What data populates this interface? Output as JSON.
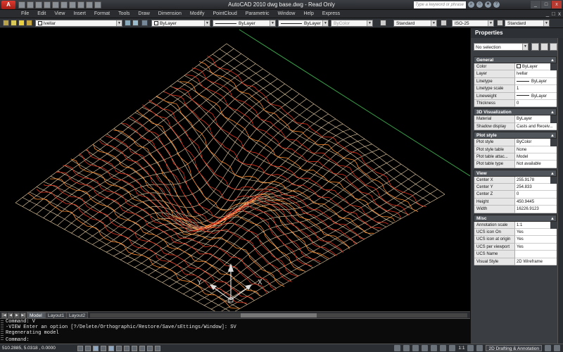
{
  "window": {
    "app_logo": "A",
    "title": "AutoCAD 2010    dwg base.dwg - Read Only",
    "search_placeholder": "Type a keyword or phrase",
    "controls": [
      "_",
      "□",
      "x"
    ]
  },
  "menu": {
    "items": [
      "File",
      "Edit",
      "View",
      "Insert",
      "Format",
      "Tools",
      "Draw",
      "Dimension",
      "Modify",
      "PointCloud",
      "Parametric",
      "Window",
      "Help",
      "Express"
    ],
    "right_controls": [
      "_",
      "□",
      "x"
    ]
  },
  "toolbar": {
    "layer": "lvellar",
    "color": "ByLayer",
    "linetype": "ByLayer",
    "lineweight": "ByLayer",
    "plot_style": "ByColor",
    "text_style": "Standard",
    "dim_style": "ISO-25",
    "table_style": "Standard"
  },
  "layout_tabs": [
    "Model",
    "Layout1",
    "Layout2"
  ],
  "ucs_axis_labels": {
    "x": "X",
    "y": "Y",
    "z": "Z"
  },
  "command_line": {
    "lines": [
      "Command: V",
      "-VIEW Enter an option [?/Delete/Orthographic/Restore/Save/sEttings/Window]: SV",
      "Regenerating model"
    ],
    "prompt": "Command:"
  },
  "status_bar": {
    "coordinates": "510.2885, 5.0318  , 0.0000",
    "scale": "1:1",
    "workspace": "2D Drafting & Annotation"
  },
  "properties": {
    "title": "Properties",
    "selection": "No selection",
    "sections": [
      {
        "name": "General",
        "rows": [
          {
            "name": "Color",
            "value": "ByLayer"
          },
          {
            "name": "Layer",
            "value": "lvellar"
          },
          {
            "name": "Linetype",
            "value": "ByLayer"
          },
          {
            "name": "Linetype scale",
            "value": "1"
          },
          {
            "name": "Lineweight",
            "value": "ByLayer"
          },
          {
            "name": "Thickness",
            "value": "0"
          }
        ]
      },
      {
        "name": "3D Visualization",
        "rows": [
          {
            "name": "Material",
            "value": "ByLayer"
          },
          {
            "name": "Shadow display",
            "value": "Casts and Receiv..."
          }
        ]
      },
      {
        "name": "Plot style",
        "rows": [
          {
            "name": "Plot style",
            "value": "ByColor"
          },
          {
            "name": "Plot style table",
            "value": "None"
          },
          {
            "name": "Plot table attac...",
            "value": "Model"
          },
          {
            "name": "Plot table type",
            "value": "Not available"
          }
        ]
      },
      {
        "name": "View",
        "rows": [
          {
            "name": "Center X",
            "value": "255.9178"
          },
          {
            "name": "Center Y",
            "value": "254.833"
          },
          {
            "name": "Center Z",
            "value": "0"
          },
          {
            "name": "Height",
            "value": "450.9445"
          },
          {
            "name": "Width",
            "value": "16226.9123"
          }
        ]
      },
      {
        "name": "Misc",
        "rows": [
          {
            "name": "Annotation scale",
            "value": "1:1"
          },
          {
            "name": "UCS icon On",
            "value": "Yes"
          },
          {
            "name": "UCS icon at origin",
            "value": "Yes"
          },
          {
            "name": "UCS per viewport",
            "value": "Yes"
          },
          {
            "name": "UCS Name",
            "value": ""
          },
          {
            "name": "Visual Style",
            "value": "2D Wireframe"
          }
        ]
      }
    ]
  },
  "colors": {
    "mesh_light": "#ecd2a8",
    "mesh_red": "#e0311c",
    "mesh_orange": "#ff8a2a",
    "green_line": "#3aa34a",
    "background": "#000000"
  }
}
